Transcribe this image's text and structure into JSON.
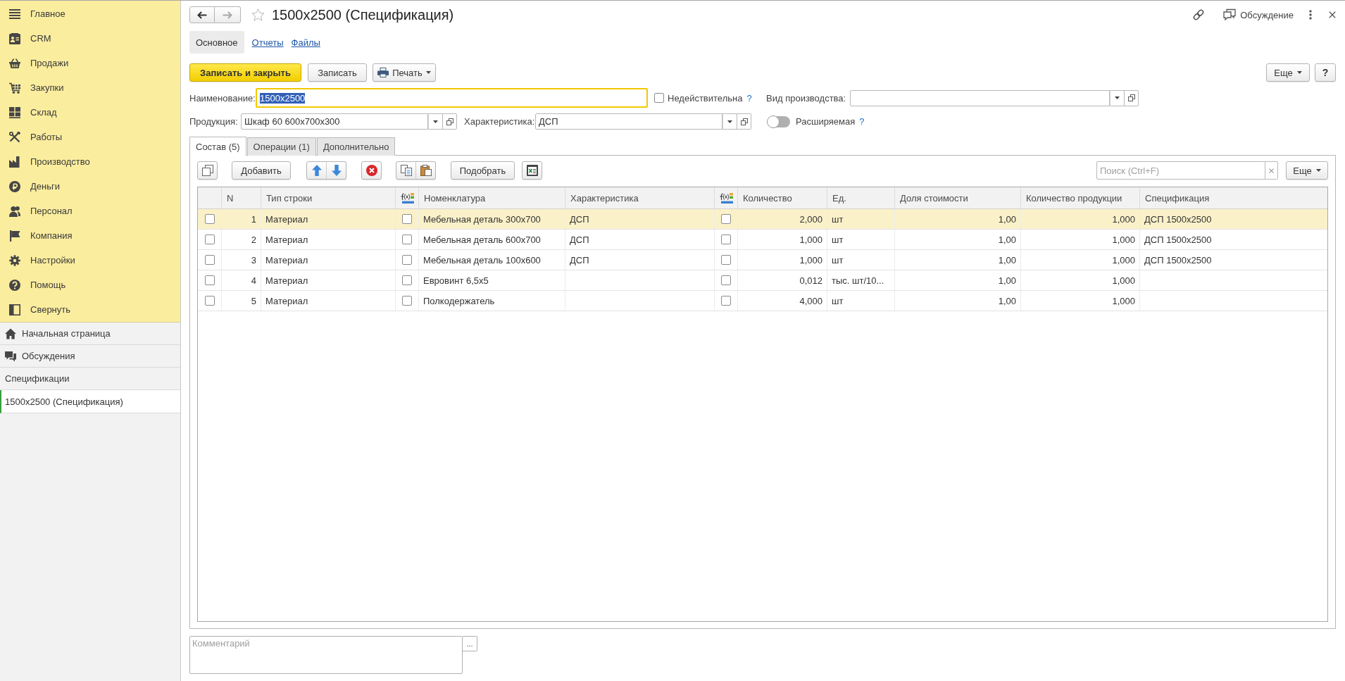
{
  "sidebar": {
    "sections": [
      {
        "label": "Главное"
      },
      {
        "label": "CRM"
      },
      {
        "label": "Продажи"
      },
      {
        "label": "Закупки"
      },
      {
        "label": "Склад"
      },
      {
        "label": "Работы"
      },
      {
        "label": "Производство"
      },
      {
        "label": "Деньги"
      },
      {
        "label": "Персонал"
      },
      {
        "label": "Компания"
      },
      {
        "label": "Настройки"
      },
      {
        "label": "Помощь"
      },
      {
        "label": "Свернуть"
      }
    ],
    "links": [
      {
        "label": "Начальная страница"
      },
      {
        "label": "Обсуждения"
      }
    ],
    "open_windows": {
      "heading": "Спецификации",
      "items": [
        {
          "label": "1500x2500 (Спецификация)",
          "selected": true
        }
      ]
    }
  },
  "header": {
    "navigation": {
      "back": {
        "disabled": false
      },
      "forward": {
        "disabled": true
      }
    },
    "favorite": false,
    "title": "1500x2500 (Спецификация)",
    "discussion": "Обсуждение"
  },
  "form_tabs": [
    {
      "label": "Основное",
      "selected": true
    },
    {
      "label": "Отчеты",
      "selected": false
    },
    {
      "label": "Файлы",
      "selected": false
    }
  ],
  "command_bar": {
    "buttons": [
      {
        "label": "Записать и закрыть",
        "kind": "primary"
      },
      {
        "label": "Записать",
        "kind": "plain"
      },
      {
        "label": "Печать",
        "kind": "print"
      }
    ],
    "more": "Еще",
    "help": "?"
  },
  "fields": {
    "name": {
      "label": "Наименование:",
      "value": "1500x2500",
      "focused": true
    },
    "invalid": {
      "label": "Недействительна",
      "checked": false,
      "help": "?"
    },
    "production_type": {
      "label": "Вид производства:"
    },
    "product": {
      "label": "Продукция:",
      "value": "Шкаф 60 600x700x300"
    },
    "characteristic": {
      "label": "Характеристика:",
      "value": "ДСП"
    },
    "extensible": {
      "label": "Расширяемая",
      "on": false,
      "help": "?"
    }
  },
  "content_tabs": [
    {
      "label": "Состав (5)",
      "selected": true
    },
    {
      "label": "Операции (1)",
      "selected": false
    },
    {
      "label": "Дополнительно",
      "selected": false
    }
  ],
  "table_toolbar": {
    "add": "Добавить",
    "pick": "Подобрать",
    "search": {
      "placeholder": "Поиск (Ctrl+F)"
    },
    "more": "Еще"
  },
  "table": {
    "columns": [
      {
        "kind": "check"
      },
      {
        "kind": "number",
        "label": "N"
      },
      {
        "kind": "text",
        "label": "Тип строки"
      },
      {
        "kind": "formula"
      },
      {
        "kind": "text",
        "label": "Номенклатура"
      },
      {
        "kind": "text",
        "label": "Характеристика"
      },
      {
        "kind": "formula"
      },
      {
        "kind": "number",
        "label": "Количество"
      },
      {
        "kind": "text",
        "label": "Ед."
      },
      {
        "kind": "number",
        "label": "Доля стоимости"
      },
      {
        "kind": "number",
        "label": "Количество продукции"
      },
      {
        "kind": "text",
        "label": "Спецификация"
      }
    ],
    "rows": [
      {
        "selected": true,
        "cells": [
          {
            "checked": false
          },
          {
            "text": "1"
          },
          {
            "text": "Материал"
          },
          {
            "checked": false
          },
          {
            "text": "Мебельная деталь 300x700"
          },
          {
            "text": "ДСП"
          },
          {
            "checked": false
          },
          {
            "text": "2,000"
          },
          {
            "text": "шт"
          },
          {
            "text": "1,00"
          },
          {
            "text": "1,000"
          },
          {
            "text": "ДСП 1500x2500"
          }
        ]
      },
      {
        "selected": false,
        "cells": [
          {
            "checked": false
          },
          {
            "text": "2"
          },
          {
            "text": "Материал"
          },
          {
            "checked": false
          },
          {
            "text": "Мебельная деталь 600x700"
          },
          {
            "text": "ДСП"
          },
          {
            "checked": false
          },
          {
            "text": "1,000"
          },
          {
            "text": "шт"
          },
          {
            "text": "1,00"
          },
          {
            "text": "1,000"
          },
          {
            "text": "ДСП 1500x2500"
          }
        ]
      },
      {
        "selected": false,
        "cells": [
          {
            "checked": false
          },
          {
            "text": "3"
          },
          {
            "text": "Материал"
          },
          {
            "checked": false
          },
          {
            "text": "Мебельная деталь 100x600"
          },
          {
            "text": "ДСП"
          },
          {
            "checked": false
          },
          {
            "text": "1,000"
          },
          {
            "text": "шт"
          },
          {
            "text": "1,00"
          },
          {
            "text": "1,000"
          },
          {
            "text": "ДСП 1500x2500"
          }
        ]
      },
      {
        "selected": false,
        "cells": [
          {
            "checked": false
          },
          {
            "text": "4"
          },
          {
            "text": "Материал"
          },
          {
            "checked": false
          },
          {
            "text": "Евровинт 6,5x5"
          },
          {},
          {
            "checked": false
          },
          {
            "text": "0,012"
          },
          {
            "text": "тыс. шт/10..."
          },
          {
            "text": "1,00"
          },
          {
            "text": "1,000"
          },
          {}
        ]
      },
      {
        "selected": false,
        "cells": [
          {
            "checked": false
          },
          {
            "text": "5"
          },
          {
            "text": "Материал"
          },
          {
            "checked": false
          },
          {
            "text": "Полкодержатель"
          },
          {},
          {
            "checked": false
          },
          {
            "text": "4,000"
          },
          {
            "text": "шт"
          },
          {
            "text": "1,00"
          },
          {
            "text": "1,000"
          },
          {}
        ]
      }
    ]
  },
  "comment": {
    "placeholder": "Комментарий",
    "button": "..."
  }
}
